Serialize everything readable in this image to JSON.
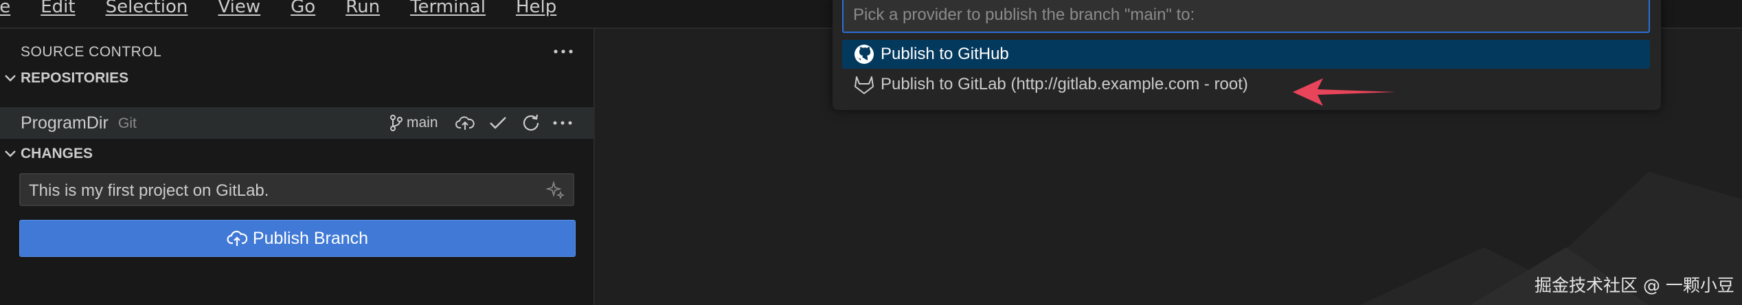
{
  "menubar": {
    "items": [
      "File",
      "Edit",
      "Selection",
      "View",
      "Go",
      "Run",
      "Terminal",
      "Help"
    ],
    "visible_first": "le"
  },
  "source_control": {
    "title": "SOURCE CONTROL",
    "repositories_title": "REPOSITORIES",
    "repo": {
      "name": "ProgramDir",
      "type": "Git",
      "branch": "main"
    },
    "changes_title": "CHANGES",
    "commit_message": "This is my first project on GitLab.",
    "publish_label": "Publish Branch"
  },
  "quick_pick": {
    "placeholder": "Pick a provider to publish the branch \"main\" to:",
    "items": [
      {
        "label": "Publish to GitHub",
        "icon": "github-icon"
      },
      {
        "label": "Publish to GitLab (http://gitlab.example.com - root)",
        "icon": "gitlab-icon"
      }
    ]
  },
  "watermark": "掘金技术社区 @ 一颗小豆",
  "colors": {
    "accent": "#2b6fd6",
    "button": "#4079d6",
    "selection": "#04395e",
    "arrow": "#e8445a"
  }
}
